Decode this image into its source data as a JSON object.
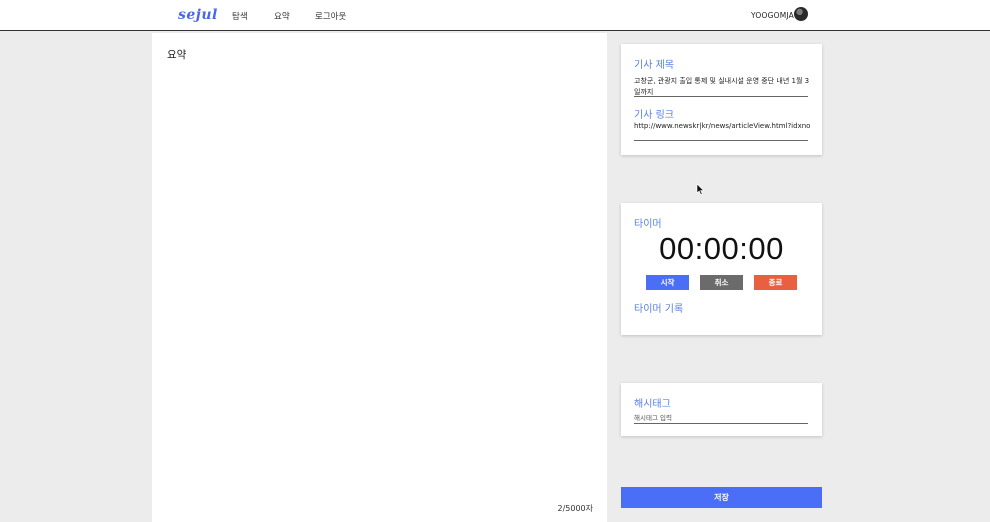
{
  "nav": {
    "logo": "sejul",
    "links": [
      "탐색",
      "요약",
      "로그아웃"
    ],
    "username": "YOOGOMJA"
  },
  "editor": {
    "title": "요약",
    "char_count": "2/5000자"
  },
  "article": {
    "title_label": "기사 제목",
    "title_value": "고창군, 관광지 출입 통제 및 실내시설 운영 중단 내년 1월 3일까지",
    "link_label": "기사 링크",
    "link_value": "http://www.newskr|kr/news/articleView.html?idxno"
  },
  "timer": {
    "label": "타이머",
    "display": "00:00:00",
    "start_label": "시작",
    "cancel_label": "취소",
    "end_label": "종료",
    "record_label": "타이머 기록"
  },
  "hashtag": {
    "label": "해시태그",
    "placeholder": "해시태그 입력"
  },
  "save_label": "저장",
  "colors": {
    "accent": "#4a6ef5",
    "label_blue": "#5b7fe0",
    "cancel_gray": "#6b6b6b",
    "end_orange": "#e8603f"
  }
}
